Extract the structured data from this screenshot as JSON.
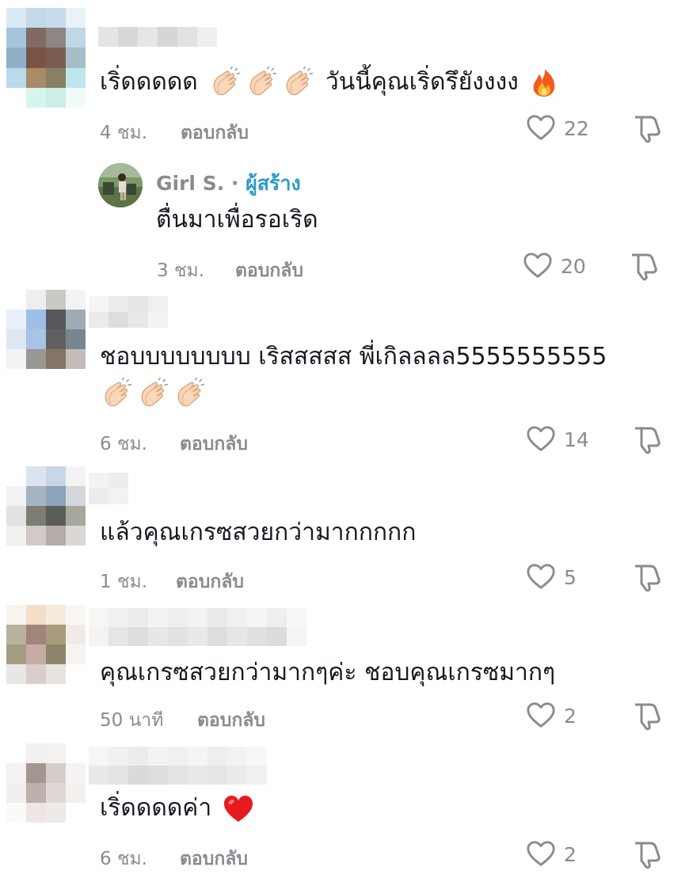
{
  "comments": [
    {
      "text": "เริ่ดดดดด",
      "text_after_emoji": "วันนี้คุณเริ่ดรึยังงงง",
      "time": "4 ชม.",
      "reply_label": "ตอบกลับ",
      "likes": "22",
      "emojis": [
        "clap-emoji",
        "clap-emoji",
        "clap-emoji",
        "fire-emoji"
      ]
    },
    {
      "time": "6 ชม.",
      "reply_label": "ตอบกลับ",
      "likes": "14",
      "text": "ชอบบบบบบบบ เริสสสสส พี่เกิลลลล5555555555",
      "emojis": [
        "clap-emoji",
        "clap-emoji",
        "clap-emoji"
      ]
    },
    {
      "text": "แล้วคุณเกรซสวยกว่ามากกกกก",
      "time": "1 ชม.",
      "reply_label": "ตอบกลับ",
      "likes": "5"
    },
    {
      "text": "คุณเกรซสวยกว่ามากๆค่ะ ชอบคุณเกรซมากๆ",
      "time": "50 นาที",
      "reply_label": "ตอบกลับ",
      "likes": "2"
    },
    {
      "text": "เริ่ดดดดค่า",
      "time": "6 ชม.",
      "reply_label": "ตอบกลับ",
      "likes": "2",
      "emojis": [
        "red-heart-emoji"
      ]
    }
  ],
  "reply": {
    "author": "Girl S.",
    "separator": "·",
    "creator_label": "ผู้สร้าง",
    "text": "ตื่นมาเพื่อรอเริด",
    "time": "3 ชม.",
    "reply_label": "ตอบกลับ",
    "likes": "20"
  },
  "colors": {
    "meta_gray": "#8a8b91",
    "creator_blue": "#2a9dc4",
    "text": "#161823"
  }
}
